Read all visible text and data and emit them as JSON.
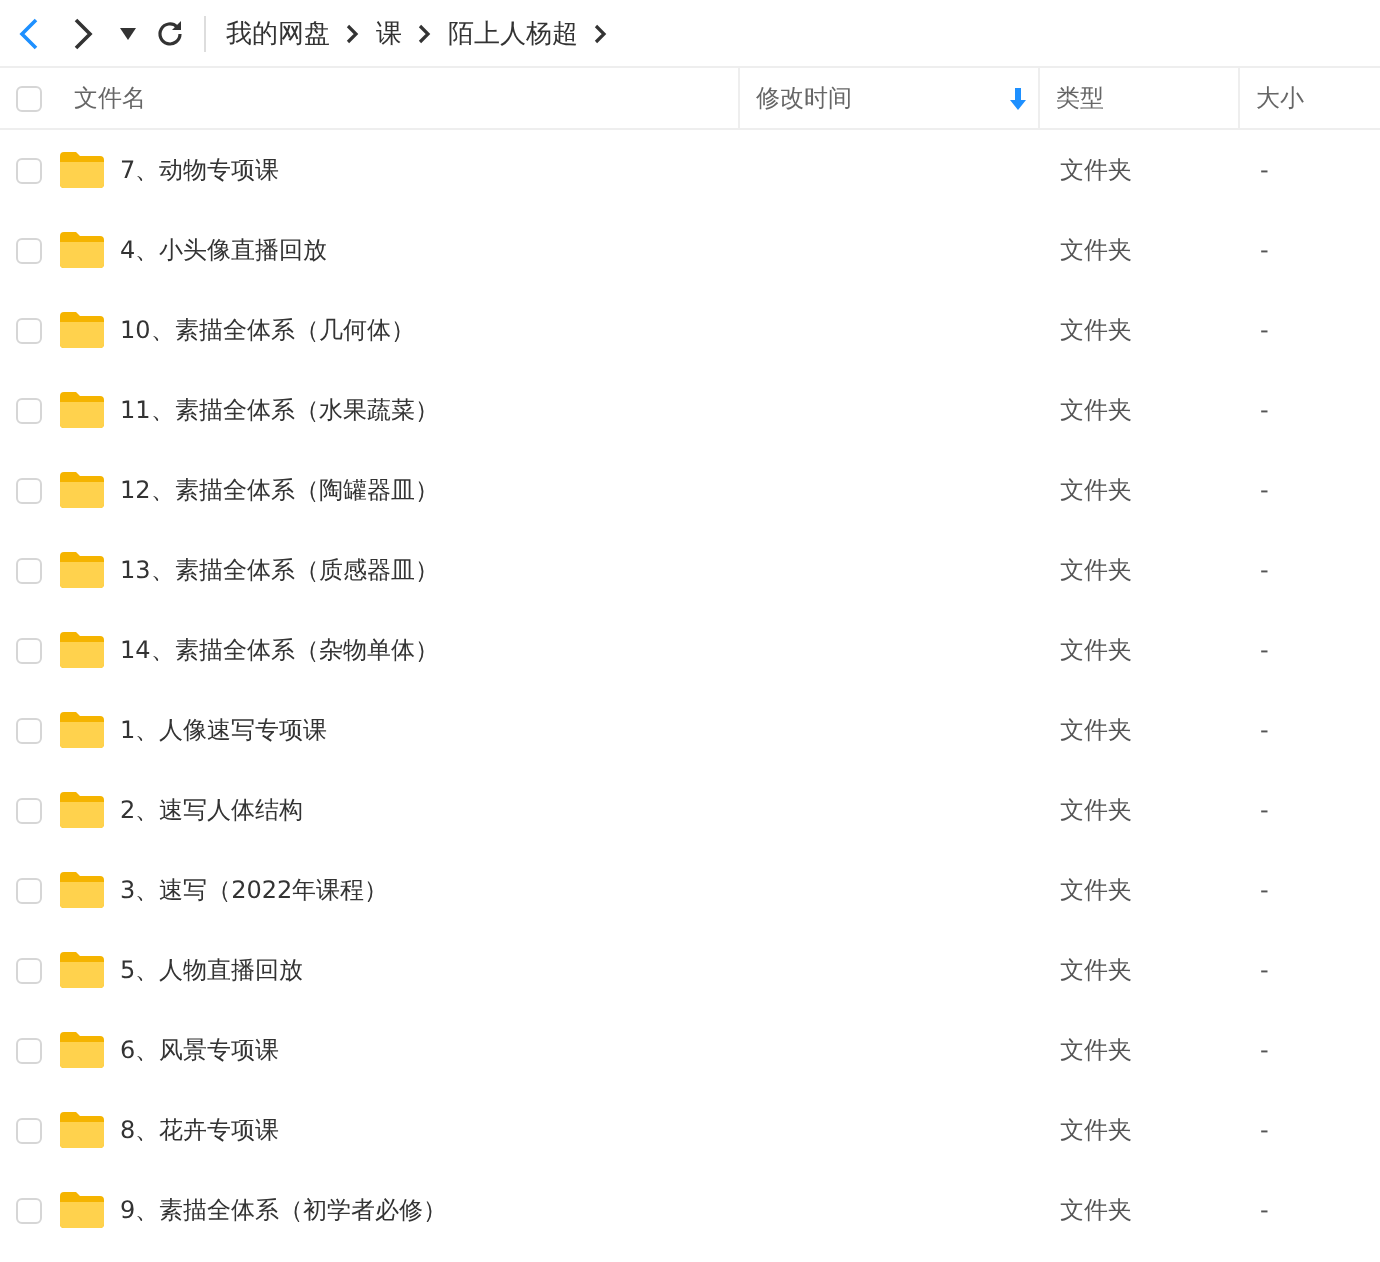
{
  "toolbar": {
    "breadcrumb": [
      {
        "label": "我的网盘"
      },
      {
        "label": "课"
      },
      {
        "label": "陌上人杨超"
      }
    ]
  },
  "table": {
    "select_all": {
      "checked": false
    },
    "columns": [
      {
        "label": "文件名"
      },
      {
        "label": "修改时间",
        "sorted": true
      },
      {
        "label": "类型"
      },
      {
        "label": "大小"
      }
    ],
    "rows": [
      {
        "name": "7、动物专项课",
        "type": "文件夹",
        "size": "-",
        "checked": false
      },
      {
        "name": "4、小头像直播回放",
        "type": "文件夹",
        "size": "-",
        "checked": false
      },
      {
        "name": "10、素描全体系（几何体）",
        "type": "文件夹",
        "size": "-",
        "checked": false
      },
      {
        "name": "11、素描全体系（水果蔬菜）",
        "type": "文件夹",
        "size": "-",
        "checked": false
      },
      {
        "name": "12、素描全体系（陶罐器皿）",
        "type": "文件夹",
        "size": "-",
        "checked": false
      },
      {
        "name": "13、素描全体系（质感器皿）",
        "type": "文件夹",
        "size": "-",
        "checked": false
      },
      {
        "name": "14、素描全体系（杂物单体）",
        "type": "文件夹",
        "size": "-",
        "checked": false
      },
      {
        "name": "1、人像速写专项课",
        "type": "文件夹",
        "size": "-",
        "checked": false
      },
      {
        "name": "2、速写人体结构",
        "type": "文件夹",
        "size": "-",
        "checked": false
      },
      {
        "name": "3、速写（2022年课程）",
        "type": "文件夹",
        "size": "-",
        "checked": false
      },
      {
        "name": "5、人物直播回放",
        "type": "文件夹",
        "size": "-",
        "checked": false
      },
      {
        "name": "6、风景专项课",
        "type": "文件夹",
        "size": "-",
        "checked": false
      },
      {
        "name": "8、花卉专项课",
        "type": "文件夹",
        "size": "-",
        "checked": false
      },
      {
        "name": "9、素描全体系（初学者必修）",
        "type": "文件夹",
        "size": "-",
        "checked": false
      }
    ]
  }
}
